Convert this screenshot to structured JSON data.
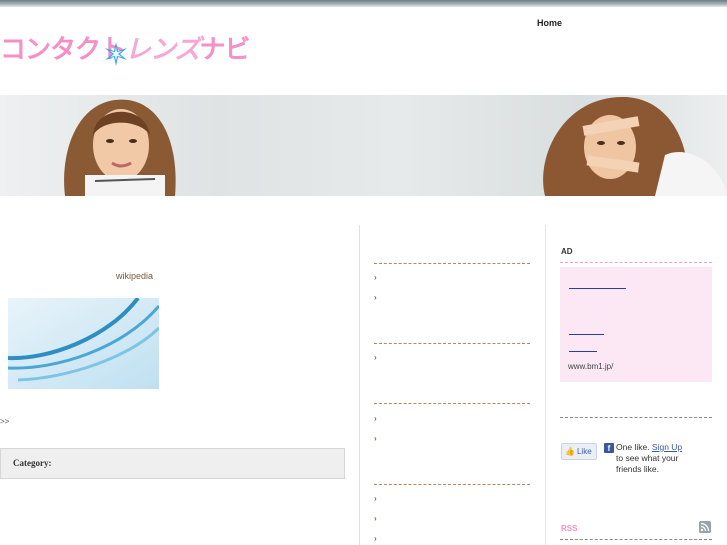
{
  "header": {
    "logo_text_1": "コンタクト",
    "logo_text_2": "レンズ",
    "logo_text_3": "ナビ",
    "nav_home": "Home"
  },
  "main": {
    "wiki_link": "wikipedia",
    "more_link": ">>",
    "category_label": "Category:"
  },
  "sidebar": {
    "ad_title": "AD",
    "ad_url": "www.bm1.jp/",
    "like_button": "Like",
    "fb_text_pre": "One like.",
    "fb_sign_up": "Sign Up",
    "fb_text_post": "to see what your friends like.",
    "rss_label": "RSS"
  },
  "colors": {
    "brand_pink": "#f58fc6",
    "ad_bg": "#fbe8f4",
    "bullet": "#a0522d"
  }
}
